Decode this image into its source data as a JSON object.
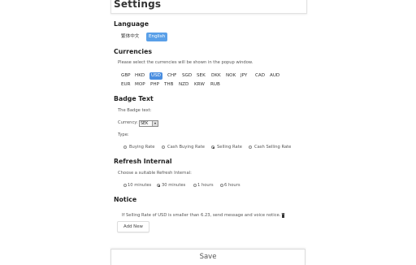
{
  "page": {
    "title": "Settings"
  },
  "language": {
    "heading": "Language",
    "options": [
      {
        "label": "繁体中文",
        "selected": false
      },
      {
        "label": "English",
        "selected": true
      }
    ]
  },
  "currencies": {
    "heading": "Currencies",
    "description": "Please select the currencies will be shown in the popup window.",
    "row1": [
      "GBP",
      "HKD",
      "USD",
      "CHF",
      "SGD",
      "SEK",
      "DKK",
      "NOK",
      "JPY",
      "CAD",
      "AUD"
    ],
    "row2": [
      "EUR",
      "MOP",
      "PHP",
      "THB",
      "NZD",
      "KRW",
      "RUB"
    ],
    "selected": "USD",
    "accent_color": "#4a8ee0"
  },
  "badge_text": {
    "heading": "Badge Text",
    "description": "The Badge text:",
    "currency_label": "Currency:",
    "currency_value": "SEK",
    "type_label": "Type:",
    "types": [
      {
        "label": "Buying Rate",
        "selected": false
      },
      {
        "label": "Cash Buying Rate",
        "selected": false
      },
      {
        "label": "Selling Rate",
        "selected": true
      },
      {
        "label": "Cash Selling Rate",
        "selected": false
      }
    ]
  },
  "refresh_interval": {
    "heading": "Refresh Internal",
    "description": "Choose a suitable Refresh Internal:",
    "options": [
      {
        "label": "10 minutes",
        "selected": false
      },
      {
        "label": "30 minutes",
        "selected": true
      },
      {
        "label": "1 hours",
        "selected": false
      },
      {
        "label": "6 hours",
        "selected": false
      }
    ]
  },
  "notice": {
    "heading": "Notice",
    "rule_text": "If Selling Rate of USD is smaller than 6.23, send message and voice notice.",
    "delete_icon": "trash-icon",
    "add_button": "Add New"
  },
  "footer": {
    "save_label": "Save"
  }
}
